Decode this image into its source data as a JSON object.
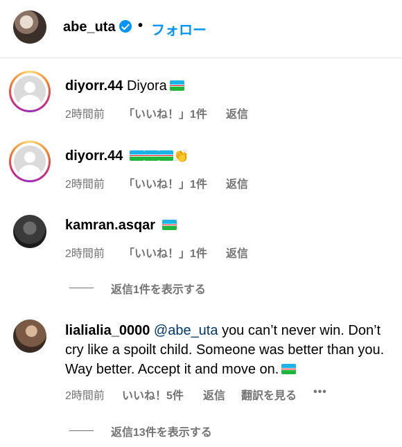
{
  "header": {
    "username": "abe_uta",
    "separator": "•",
    "follow_label": "フォロー"
  },
  "comments": [
    {
      "username": "diyorr.44",
      "text": "Diyora",
      "time": "2時間前",
      "likes": "「いいね！」1件",
      "reply": "返信"
    },
    {
      "username": "diyorr.44",
      "text": "",
      "emoji": "👏",
      "time": "2時間前",
      "likes": "「いいね！」1件",
      "reply": "返信"
    },
    {
      "username": "kamran.asqar",
      "text": "",
      "time": "2時間前",
      "likes": "「いいね！」1件",
      "reply": "返信",
      "view_replies": "返信1件を表示する"
    },
    {
      "username": "lialialia_0000",
      "mention": "@abe_uta",
      "line1": "you can’t never win. Don’t",
      "line2": "cry like a spoilt child. Someone was better than you.",
      "line3": "Way better. Accept it and move on.",
      "time": "2時間前",
      "likes": "いいね！5件",
      "reply": "返信",
      "translate": "翻訳を見る",
      "more": "•••",
      "view_replies": "返信13件を表示する"
    }
  ],
  "icons": {
    "verified": "verified-badge-icon",
    "flag": "uzbekistan-flag-icon",
    "clap": "clapping-hands-icon",
    "more": "more-options-icon"
  },
  "colors": {
    "accent": "#0095f6",
    "secondary_text": "#737373",
    "mention": "#00376b"
  }
}
